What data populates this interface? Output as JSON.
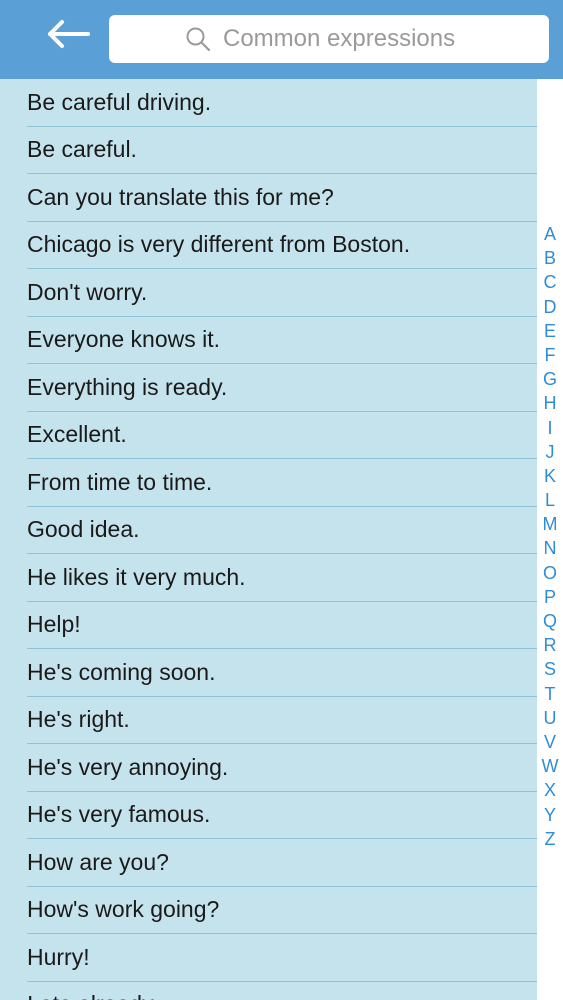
{
  "header": {
    "back_icon": "left-arrow-icon",
    "search": {
      "placeholder": "Common expressions",
      "icon": "search-icon"
    }
  },
  "colors": {
    "header_bg": "#5a9fd6",
    "list_bg": "#c5e3ec",
    "divider": "#8fc3d6",
    "index_letter": "#2f8cd8"
  },
  "expressions": [
    "Be careful driving.",
    "Be careful.",
    "Can you translate this for me?",
    "Chicago is very different from Boston.",
    "Don't worry.",
    "Everyone knows it.",
    "Everything is ready.",
    "Excellent.",
    "From time to time.",
    "Good idea.",
    "He likes it very much.",
    "Help!",
    "He's coming soon.",
    "He's right.",
    "He's very annoying.",
    "He's very famous.",
    "How are you?",
    "How's work going?",
    "Hurry!",
    "I ate already."
  ],
  "index_letters": [
    "A",
    "B",
    "C",
    "D",
    "E",
    "F",
    "G",
    "H",
    "I",
    "J",
    "K",
    "L",
    "M",
    "N",
    "O",
    "P",
    "Q",
    "R",
    "S",
    "T",
    "U",
    "V",
    "W",
    "X",
    "Y",
    "Z"
  ]
}
